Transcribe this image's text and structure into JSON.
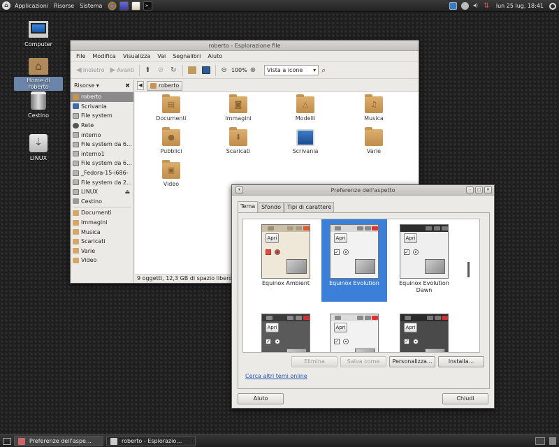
{
  "top_panel": {
    "menus": [
      "Applicazioni",
      "Risorse",
      "Sistema"
    ],
    "clock": "lun 25 lug, 18:41"
  },
  "desktop_icons": [
    {
      "label": "Computer"
    },
    {
      "label": "Home di roberto"
    },
    {
      "label": "Cestino"
    },
    {
      "label": "LINUX"
    }
  ],
  "file_manager": {
    "title": "roberto - Esplorazione file",
    "menu": [
      "File",
      "Modifica",
      "Visualizza",
      "Vai",
      "Segnalibri",
      "Aiuto"
    ],
    "toolbar": {
      "back": "Indietro",
      "forward": "Avanti",
      "zoom": "100%",
      "view_mode": "Vista a icone"
    },
    "sidebar": {
      "header": "Risorse",
      "items": [
        {
          "label": "roberto",
          "icon": "home"
        },
        {
          "label": "Scrivania",
          "icon": "desktop"
        },
        {
          "label": "File system",
          "icon": "drive"
        },
        {
          "label": "Rete",
          "icon": "network"
        },
        {
          "label": "interno",
          "icon": "drive"
        },
        {
          "label": "File system da 6…",
          "icon": "drive"
        },
        {
          "label": "interno1",
          "icon": "drive"
        },
        {
          "label": "File system da 6…",
          "icon": "drive"
        },
        {
          "label": "_Fedora-15-i686-",
          "icon": "drive"
        },
        {
          "label": "File system da 2…",
          "icon": "drive"
        },
        {
          "label": "LINUX",
          "icon": "drive"
        },
        {
          "label": "Cestino",
          "icon": "trash"
        }
      ],
      "bookmarks": [
        {
          "label": "Documenti"
        },
        {
          "label": "Immagini"
        },
        {
          "label": "Musica"
        },
        {
          "label": "Scaricati"
        },
        {
          "label": "Varie"
        },
        {
          "label": "Video"
        }
      ]
    },
    "path": "roberto",
    "files": [
      {
        "name": "Documenti",
        "icon": "folder-documents"
      },
      {
        "name": "Immagini",
        "icon": "folder-pictures"
      },
      {
        "name": "Modelli",
        "icon": "folder-templates"
      },
      {
        "name": "Musica",
        "icon": "folder-music"
      },
      {
        "name": "Pubblici",
        "icon": "folder-public"
      },
      {
        "name": "Scaricati",
        "icon": "folder-download"
      },
      {
        "name": "Scrivania",
        "icon": "desktop"
      },
      {
        "name": "Varie",
        "icon": "folder"
      },
      {
        "name": "Video",
        "icon": "folder-videos"
      }
    ],
    "status": "9 oggetti, 12,3 GB di spazio libero"
  },
  "appearance": {
    "title": "Preferenze dell'aspetto",
    "tabs": [
      "Tema",
      "Sfondo",
      "Tipi di carattere"
    ],
    "active_tab": "Tema",
    "themes": [
      {
        "name": "Equinox Ambient",
        "button": "Apri",
        "selected": false
      },
      {
        "name": "Equinox Evolution",
        "button": "Apri",
        "selected": true
      },
      {
        "name": "Equinox Evolution Dawn",
        "button": "Apri",
        "selected": false
      },
      {
        "name": "",
        "button": "Apri",
        "selected": false
      },
      {
        "name": "",
        "button": "Apri",
        "selected": false
      },
      {
        "name": "",
        "button": "Apri",
        "selected": false
      }
    ],
    "buttons": {
      "delete": "Elimina",
      "save_as": "Salva come",
      "customize": "Personalizza...",
      "install": "Installa..."
    },
    "more_themes_link": "Cerca altri temi online",
    "help": "Aiuto",
    "close": "Chiudi"
  },
  "taskbar": [
    {
      "label": "Preferenze dell'aspe…",
      "active": true
    },
    {
      "label": "roberto - Esplorazio…",
      "active": false
    }
  ],
  "colors": {
    "selection": "#3c7fd8",
    "folder": "#d4a667",
    "link": "#1f55b0"
  }
}
